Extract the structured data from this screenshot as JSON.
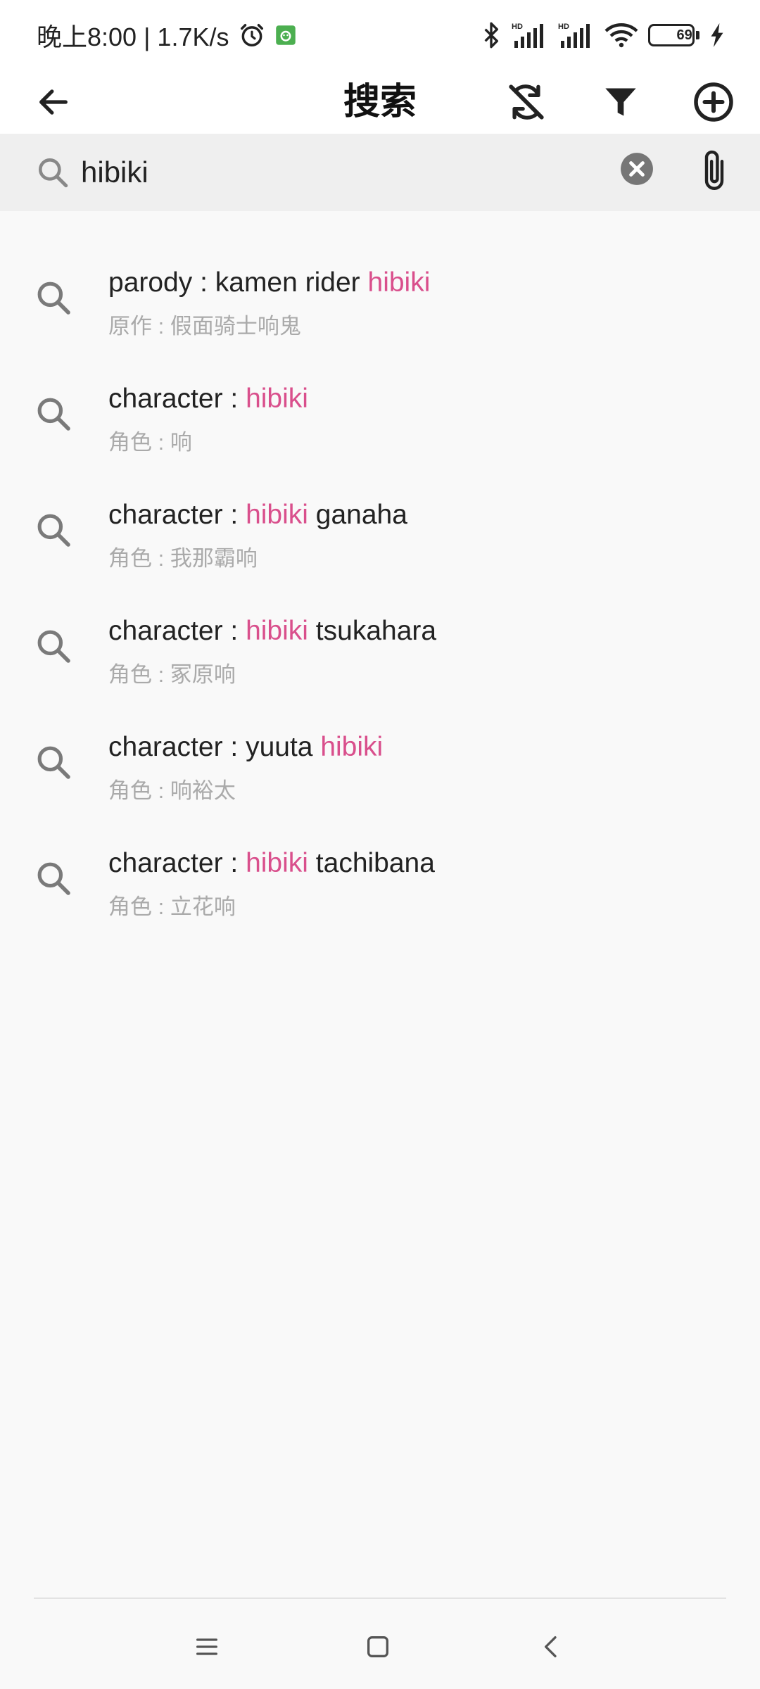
{
  "status_bar": {
    "time_speed": "晚上8:00 | 1.7K/s",
    "battery_level": "69",
    "battery_percent": 69,
    "icons": [
      "alarm-icon",
      "app-notification-icon",
      "bluetooth-icon",
      "signal-hd-icon",
      "signal-hd-icon",
      "wifi-icon",
      "battery-icon",
      "charging-icon"
    ]
  },
  "app_bar": {
    "title": "搜索",
    "actions": [
      "back-arrow-icon",
      "sync-off-icon",
      "filter-icon",
      "add-circle-icon"
    ]
  },
  "search": {
    "value": "hibiki",
    "placeholder": ""
  },
  "suggestions": [
    {
      "prefix": "parody : kamen rider ",
      "highlight": "hibiki",
      "suffix": "",
      "translation": "原作 : 假面骑士响鬼"
    },
    {
      "prefix": "character : ",
      "highlight": "hibiki",
      "suffix": "",
      "translation": "角色 : 响"
    },
    {
      "prefix": "character : ",
      "highlight": "hibiki",
      "suffix": " ganaha",
      "translation": "角色 : 我那霸响"
    },
    {
      "prefix": "character : ",
      "highlight": "hibiki",
      "suffix": " tsukahara",
      "translation": "角色 : 冢原响"
    },
    {
      "prefix": "character : yuuta ",
      "highlight": "hibiki",
      "suffix": "",
      "translation": "角色 : 响裕太"
    },
    {
      "prefix": "character : ",
      "highlight": "hibiki",
      "suffix": " tachibana",
      "translation": "角色 : 立花响"
    }
  ],
  "colors": {
    "highlight": "#d94f8c",
    "subtitle": "#aaaaaa",
    "background": "#f9f9f9",
    "search_bar": "#efefef"
  },
  "nav_bar": [
    "menu-icon",
    "home-square-icon",
    "back-chevron-icon"
  ]
}
